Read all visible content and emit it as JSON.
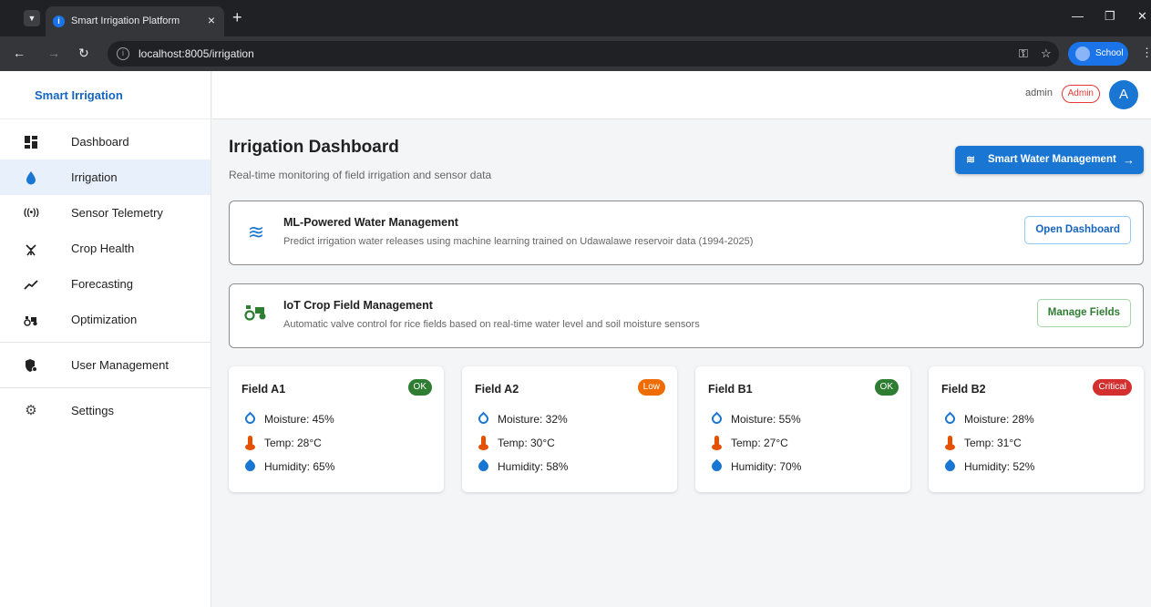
{
  "browser": {
    "tab_title": "Smart Irrigation Platform",
    "url": "localhost:8005/irrigation",
    "profile_label": "School"
  },
  "sidebar": {
    "brand": "Smart Irrigation",
    "items": [
      {
        "label": "Dashboard",
        "icon": "dashboard-icon"
      },
      {
        "label": "Irrigation",
        "icon": "water-drop-icon"
      },
      {
        "label": "Sensor Telemetry",
        "icon": "sensors-icon"
      },
      {
        "label": "Crop Health",
        "icon": "crop-icon"
      },
      {
        "label": "Forecasting",
        "icon": "trend-icon"
      },
      {
        "label": "Optimization",
        "icon": "tractor-icon"
      }
    ],
    "admin_items": [
      {
        "label": "User Management",
        "icon": "admin-shield-icon"
      }
    ],
    "bottom_items": [
      {
        "label": "Settings",
        "icon": "gear-icon"
      }
    ]
  },
  "topbar": {
    "username": "admin",
    "role": "Admin",
    "avatar_letter": "A"
  },
  "page": {
    "title": "Irrigation Dashboard",
    "subtitle": "Real-time monitoring of field irrigation and sensor data",
    "primary_button": "Smart Water Management"
  },
  "features": [
    {
      "title": "ML-Powered Water Management",
      "description": "Predict irrigation water releases using machine learning trained on Udawalawe reservoir data (1994-2025)",
      "button": "Open Dashboard",
      "icon": "waves-icon"
    },
    {
      "title": "IoT Crop Field Management",
      "description": "Automatic valve control for rice fields based on real-time water level and soil moisture sensors",
      "button": "Manage Fields",
      "icon": "tractor-icon"
    }
  ],
  "fields": [
    {
      "name": "Field A1",
      "status": "OK",
      "status_color": "#2e7d32",
      "moisture": "Moisture: 45%",
      "temp": "Temp: 28°C",
      "humidity": "Humidity: 65%"
    },
    {
      "name": "Field A2",
      "status": "Low",
      "status_color": "#ef6c00",
      "moisture": "Moisture: 32%",
      "temp": "Temp: 30°C",
      "humidity": "Humidity: 58%"
    },
    {
      "name": "Field B1",
      "status": "OK",
      "status_color": "#2e7d32",
      "moisture": "Moisture: 55%",
      "temp": "Temp: 27°C",
      "humidity": "Humidity: 70%"
    },
    {
      "name": "Field B2",
      "status": "Critical",
      "status_color": "#d32f2f",
      "moisture": "Moisture: 28%",
      "temp": "Temp: 31°C",
      "humidity": "Humidity: 52%"
    }
  ],
  "colors": {
    "primary": "#1976d2",
    "accent_green": "#2e7d32",
    "temp": "#e65100"
  }
}
